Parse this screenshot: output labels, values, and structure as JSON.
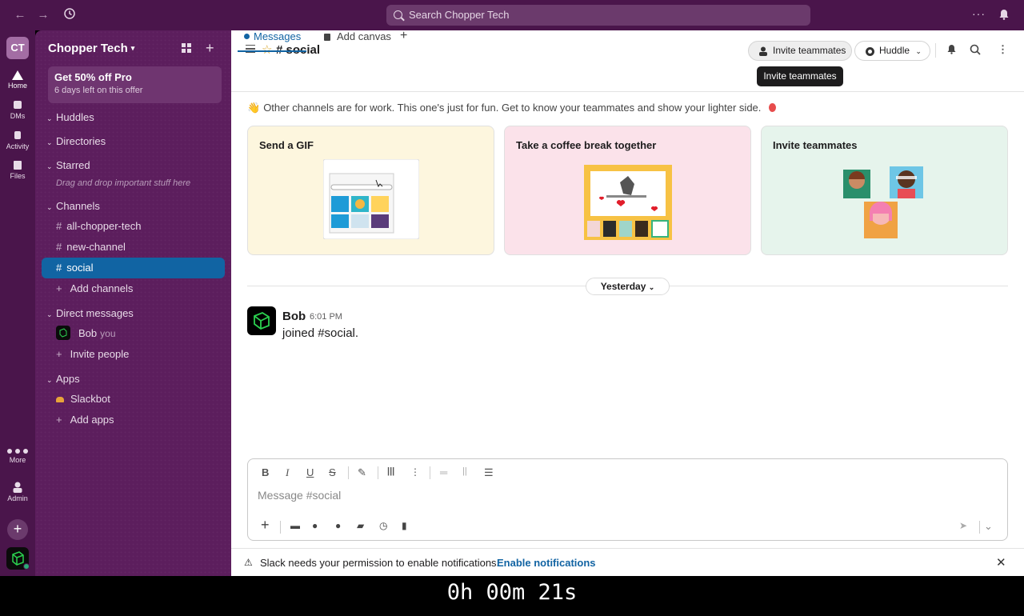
{
  "topbar": {
    "search_placeholder": "Search Chopper Tech",
    "more_label": "···"
  },
  "rail": {
    "workspace_initials": "CT",
    "items": [
      {
        "label": "Home",
        "icon": "home-icon"
      },
      {
        "label": "DMs",
        "icon": "dms-icon"
      },
      {
        "label": "Activity",
        "icon": "bell-icon"
      },
      {
        "label": "Files",
        "icon": "files-icon"
      },
      {
        "label": "More",
        "icon": "more-icon"
      },
      {
        "label": "Admin",
        "icon": "admin-icon"
      }
    ],
    "add_label": "+"
  },
  "sidebar": {
    "workspace_name": "Chopper Tech",
    "promo_title": "Get 50% off Pro",
    "promo_subtitle": "6 days left on this offer",
    "sections": {
      "huddles": "Huddles",
      "directories": "Directories",
      "starred": "Starred",
      "starred_hint": "Drag and drop important stuff here",
      "channels": "Channels",
      "direct_messages": "Direct messages",
      "apps": "Apps"
    },
    "channels": [
      "all-chopper-tech",
      "new-channel",
      "social"
    ],
    "add_channels": "Add channels",
    "dm_user": "Bob",
    "dm_you": "you",
    "invite_people": "Invite people",
    "apps": [
      "Slackbot"
    ],
    "add_apps": "Add apps"
  },
  "channel": {
    "title": "# social",
    "invite_button": "Invite teammates",
    "huddle_button": "Huddle",
    "tabs": [
      "Messages",
      "Add canvas"
    ],
    "tooltip": "Invite teammates",
    "welcome": "Other channels are for work. This one's just for fun. Get to know your teammates and show your lighter side.",
    "cards": [
      "Send a GIF",
      "Take a coffee break together",
      "Invite teammates"
    ],
    "date_divider": "Yesterday",
    "message": {
      "author": "Bob",
      "time": "6:01 PM",
      "text": "joined #social."
    },
    "composer_placeholder": "Message #social",
    "notification_text": "Slack needs your permission to enable notifications.",
    "notification_link": "Enable notifications"
  },
  "timer": "0h 00m 21s",
  "colors": {
    "aubergine": "#4a154b",
    "sidebar": "#5c1e5d",
    "active_channel": "#1164a3",
    "link": "#1264a3"
  }
}
